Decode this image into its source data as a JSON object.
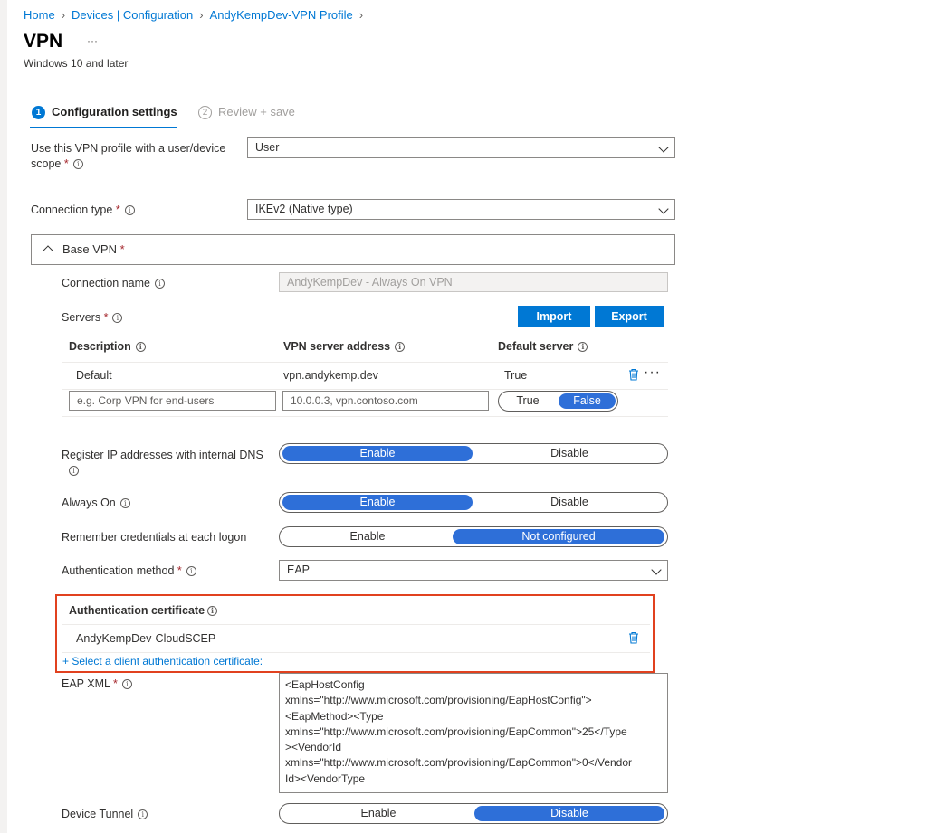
{
  "breadcrumb": [
    "Home",
    "Devices | Configuration",
    "AndyKempDev-VPN Profile"
  ],
  "page": {
    "title": "VPN",
    "more": "···",
    "subtitle": "Windows 10 and later"
  },
  "steps": [
    {
      "num": "1",
      "label": "Configuration settings"
    },
    {
      "num": "2",
      "label": "Review + save"
    }
  ],
  "fields": {
    "scope": {
      "label_line1": "Use this VPN profile with a user/device",
      "label_line2": "scope",
      "value": "User"
    },
    "connection_type": {
      "label": "Connection type",
      "value": "IKEv2 (Native type)"
    }
  },
  "base_vpn": {
    "title": "Base VPN",
    "connection_name": {
      "label": "Connection name",
      "value": "AndyKempDev - Always On VPN"
    },
    "servers": {
      "label": "Servers",
      "import_label": "Import",
      "export_label": "Export",
      "columns": [
        "Description",
        "VPN server address",
        "Default server"
      ],
      "rows": [
        {
          "description": "Default",
          "address": "vpn.andykemp.dev",
          "default": "True"
        }
      ],
      "new_row": {
        "description_placeholder": "e.g. Corp VPN for end-users",
        "address_placeholder": "10.0.0.3, vpn.contoso.com",
        "true_label": "True",
        "false_label": "False"
      }
    },
    "register_dns": {
      "label_line1": "Register IP addresses with internal DNS",
      "enable": "Enable",
      "disable": "Disable"
    },
    "always_on": {
      "label": "Always On",
      "enable": "Enable",
      "disable": "Disable"
    },
    "remember_credentials": {
      "label": "Remember credentials at each logon",
      "enable": "Enable",
      "not_configured": "Not configured"
    },
    "auth_method": {
      "label": "Authentication method",
      "value": "EAP"
    },
    "auth_cert": {
      "title": "Authentication certificate",
      "item": "AndyKempDev-CloudSCEP",
      "select_link": "+ Select a client authentication certificate:"
    },
    "eap_xml": {
      "label": "EAP XML",
      "value": "<EapHostConfig\nxmlns=\"http://www.microsoft.com/provisioning/EapHostConfig\">\n<EapMethod><Type\nxmlns=\"http://www.microsoft.com/provisioning/EapCommon\">25</Type\n><VendorId\nxmlns=\"http://www.microsoft.com/provisioning/EapCommon\">0</Vendor\nId><VendorType"
    },
    "device_tunnel": {
      "label": "Device Tunnel",
      "enable": "Enable",
      "disable": "Disable"
    }
  },
  "colors": {
    "accent": "#0078d4",
    "toggle_on": "#2e6fd8",
    "required": "#a4262c",
    "highlight_border": "#e1411f"
  }
}
